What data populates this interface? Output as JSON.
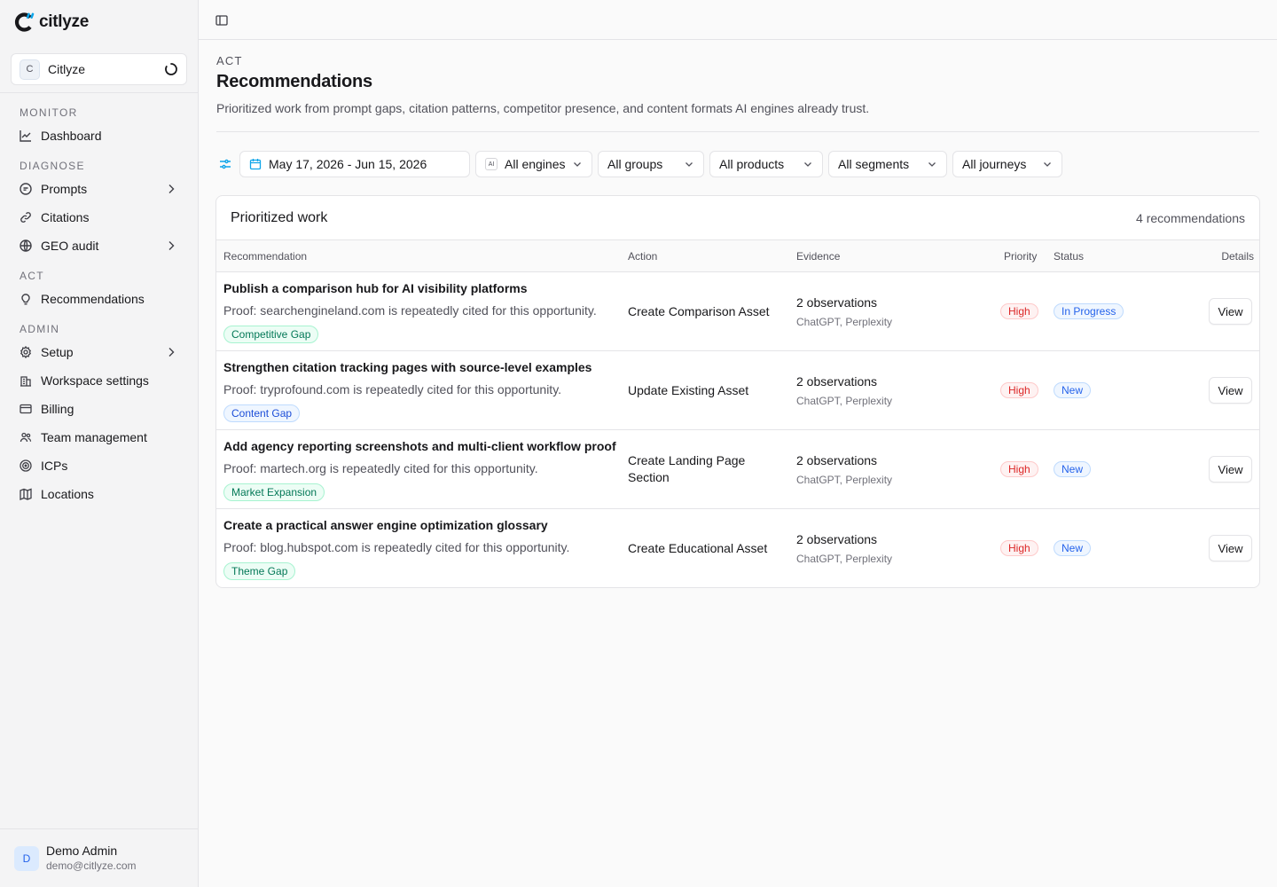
{
  "brand": {
    "name": "citlyze"
  },
  "workspace": {
    "initial": "C",
    "name": "Citlyze"
  },
  "sidebar": {
    "sections": [
      {
        "label": "MONITOR",
        "items": [
          {
            "label": "Dashboard",
            "icon": "chart-line-icon"
          }
        ]
      },
      {
        "label": "DIAGNOSE",
        "items": [
          {
            "label": "Prompts",
            "icon": "message-icon",
            "has_children": true
          },
          {
            "label": "Citations",
            "icon": "link-icon"
          },
          {
            "label": "GEO audit",
            "icon": "globe-icon",
            "has_children": true
          }
        ]
      },
      {
        "label": "ACT",
        "items": [
          {
            "label": "Recommendations",
            "icon": "lightbulb-icon"
          }
        ]
      },
      {
        "label": "ADMIN",
        "items": [
          {
            "label": "Setup",
            "icon": "gear-icon",
            "has_children": true
          },
          {
            "label": "Workspace settings",
            "icon": "building-icon"
          },
          {
            "label": "Billing",
            "icon": "credit-card-icon"
          },
          {
            "label": "Team management",
            "icon": "users-icon"
          },
          {
            "label": "ICPs",
            "icon": "target-icon"
          },
          {
            "label": "Locations",
            "icon": "map-icon"
          }
        ]
      }
    ]
  },
  "user": {
    "initial": "D",
    "name": "Demo Admin",
    "email": "demo@citlyze.com"
  },
  "page": {
    "eyebrow": "ACT",
    "title": "Recommendations",
    "subtitle": "Prioritized work from prompt gaps, citation patterns, competitor presence, and content formats AI engines already trust."
  },
  "filters": {
    "date_range": "May 17, 2026 - Jun 15, 2026",
    "engines_badge": "AI",
    "engines": "All engines",
    "groups": "All groups",
    "products": "All products",
    "segments": "All segments",
    "journeys": "All journeys"
  },
  "table": {
    "title": "Prioritized work",
    "count": "4 recommendations",
    "columns": [
      "Recommendation",
      "Action",
      "Evidence",
      "Priority",
      "Status",
      "Details"
    ],
    "rows": [
      {
        "title": "Publish a comparison hub for AI visibility platforms",
        "proof": "Proof: searchengineland.com is repeatedly cited for this opportunity.",
        "tag": "Competitive Gap",
        "tag_color": "#047857",
        "action": "Create Comparison Asset",
        "observations": "2 observations",
        "engines": "ChatGPT, Perplexity",
        "priority": "High",
        "status": "In Progress",
        "details": "View"
      },
      {
        "title": "Strengthen citation tracking pages with source-level examples",
        "proof": "Proof: tryprofound.com is repeatedly cited for this opportunity.",
        "tag": "Content Gap",
        "tag_color": "#1d4ed8",
        "action": "Update Existing Asset",
        "observations": "2 observations",
        "engines": "ChatGPT, Perplexity",
        "priority": "High",
        "status": "New",
        "details": "View"
      },
      {
        "title": "Add agency reporting screenshots and multi-client workflow proof",
        "proof": "Proof: martech.org is repeatedly cited for this opportunity.",
        "tag": "Market Expansion",
        "tag_color": "#047857",
        "action": "Create Landing Page Section",
        "observations": "2 observations",
        "engines": "ChatGPT, Perplexity",
        "priority": "High",
        "status": "New",
        "details": "View"
      },
      {
        "title": "Create a practical answer engine optimization glossary",
        "proof": "Proof: blog.hubspot.com is repeatedly cited for this opportunity.",
        "tag": "Theme Gap",
        "tag_color": "#047857",
        "action": "Create Educational Asset",
        "observations": "2 observations",
        "engines": "ChatGPT, Perplexity",
        "priority": "High",
        "status": "New",
        "details": "View"
      }
    ]
  }
}
